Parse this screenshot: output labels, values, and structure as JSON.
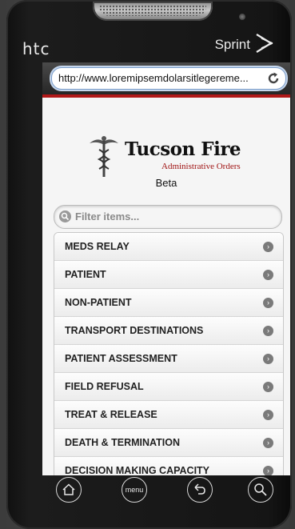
{
  "device": {
    "brand": "htc",
    "carrier": "Sprint"
  },
  "browser": {
    "url": "http://www.loremipsemdolarsitlegereme..."
  },
  "page": {
    "logo_title": "Tucson Fire",
    "logo_subtitle": "Administrative Orders",
    "beta_label": "Beta",
    "filter_placeholder": "Filter items...",
    "menu_items": [
      {
        "label": "MEDS RELAY"
      },
      {
        "label": "PATIENT"
      },
      {
        "label": "NON-PATIENT"
      },
      {
        "label": "TRANSPORT DESTINATIONS"
      },
      {
        "label": "PATIENT ASSESSMENT"
      },
      {
        "label": "FIELD REFUSAL"
      },
      {
        "label": "TREAT & RELEASE"
      },
      {
        "label": "DEATH & TERMINATION"
      },
      {
        "label": "DECISION MAKING CAPACITY"
      }
    ]
  },
  "nav": {
    "home": "home-icon",
    "menu_label": "menu",
    "back": "back-icon",
    "search": "search-icon"
  },
  "colors": {
    "accent_red": "#b01818",
    "url_border": "#7a9cc9"
  }
}
